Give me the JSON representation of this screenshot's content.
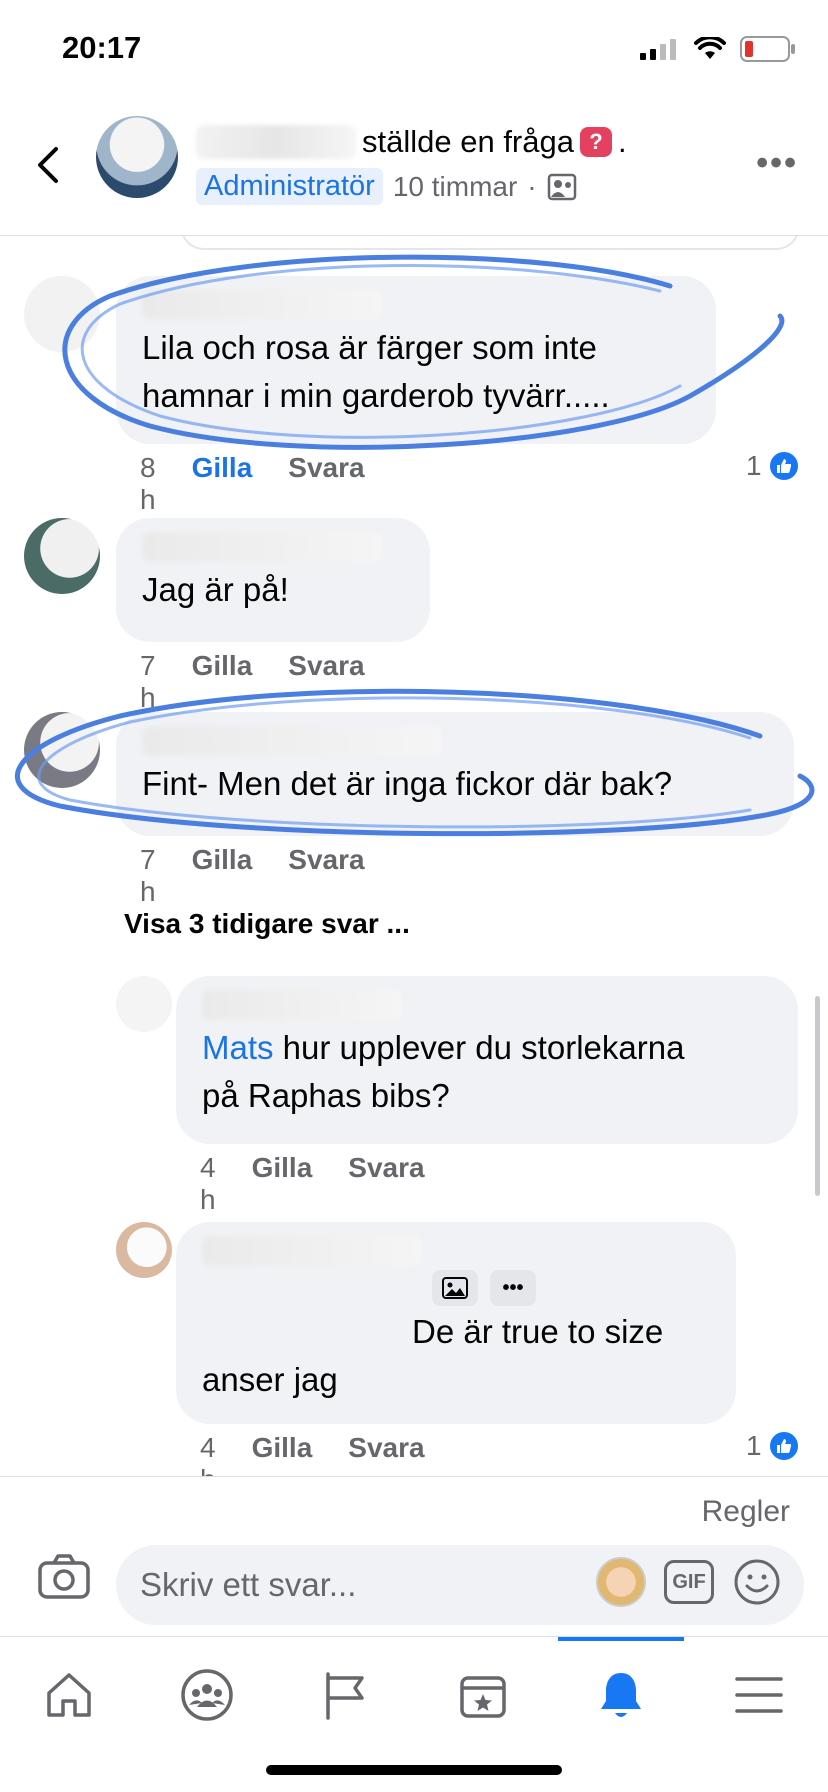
{
  "status_bar": {
    "time": "20:17",
    "icons": [
      "signal-icon",
      "wifi-icon",
      "battery-low-icon"
    ]
  },
  "header": {
    "title_suffix": "ställde en fråga",
    "title_end": ".",
    "badge": "Administratör",
    "time": "10 timmar",
    "separator": "·",
    "audience_icon": "group-photo-icon"
  },
  "comments": [
    {
      "text": "Lila och rosa är färger som inte hamnar i min garderob tyvärr.....",
      "line1": "Lila och rosa är färger som inte",
      "line2": "hamnar i min garderob tyvärr.....",
      "time": "8 h",
      "like_label": "Gilla",
      "reply_label": "Svara",
      "liked_by_me": true,
      "reactions": "1"
    },
    {
      "text": "Jag är på!",
      "time": "7 h",
      "like_label": "Gilla",
      "reply_label": "Svara"
    },
    {
      "text": "Fint- Men det är inga fickor där bak?",
      "time": "7 h",
      "like_label": "Gilla",
      "reply_label": "Svara"
    }
  ],
  "view_more_replies": "Visa 3 tidigare svar ...",
  "replies": [
    {
      "mention": "Mats",
      "text_line1": " hur upplever du storlekarna",
      "text_line2": "på Raphas bibs?",
      "time": "4 h",
      "like_label": "Gilla",
      "reply_label": "Svara"
    },
    {
      "mention": "...",
      "text_line1": "De är true to size",
      "text_line2": "anser jag",
      "time": "4 h",
      "like_label": "Gilla",
      "reply_label": "Svara",
      "reactions": "1"
    }
  ],
  "compose": {
    "rules_label": "Regler",
    "placeholder": "Skriv ett svar...",
    "gif_label": "GIF"
  },
  "bottom_nav": [
    {
      "name": "home-icon"
    },
    {
      "name": "groups-icon"
    },
    {
      "name": "pages-flag-icon"
    },
    {
      "name": "events-icon"
    },
    {
      "name": "notifications-bell-icon",
      "active": true
    },
    {
      "name": "menu-icon"
    }
  ],
  "colors": {
    "accent": "#1877f2",
    "link": "#1b74e4",
    "bubble": "#f0f2f5",
    "secondary_text": "#65676b",
    "question_badge": "#e4405f",
    "scribble": "#4a7fe0"
  }
}
